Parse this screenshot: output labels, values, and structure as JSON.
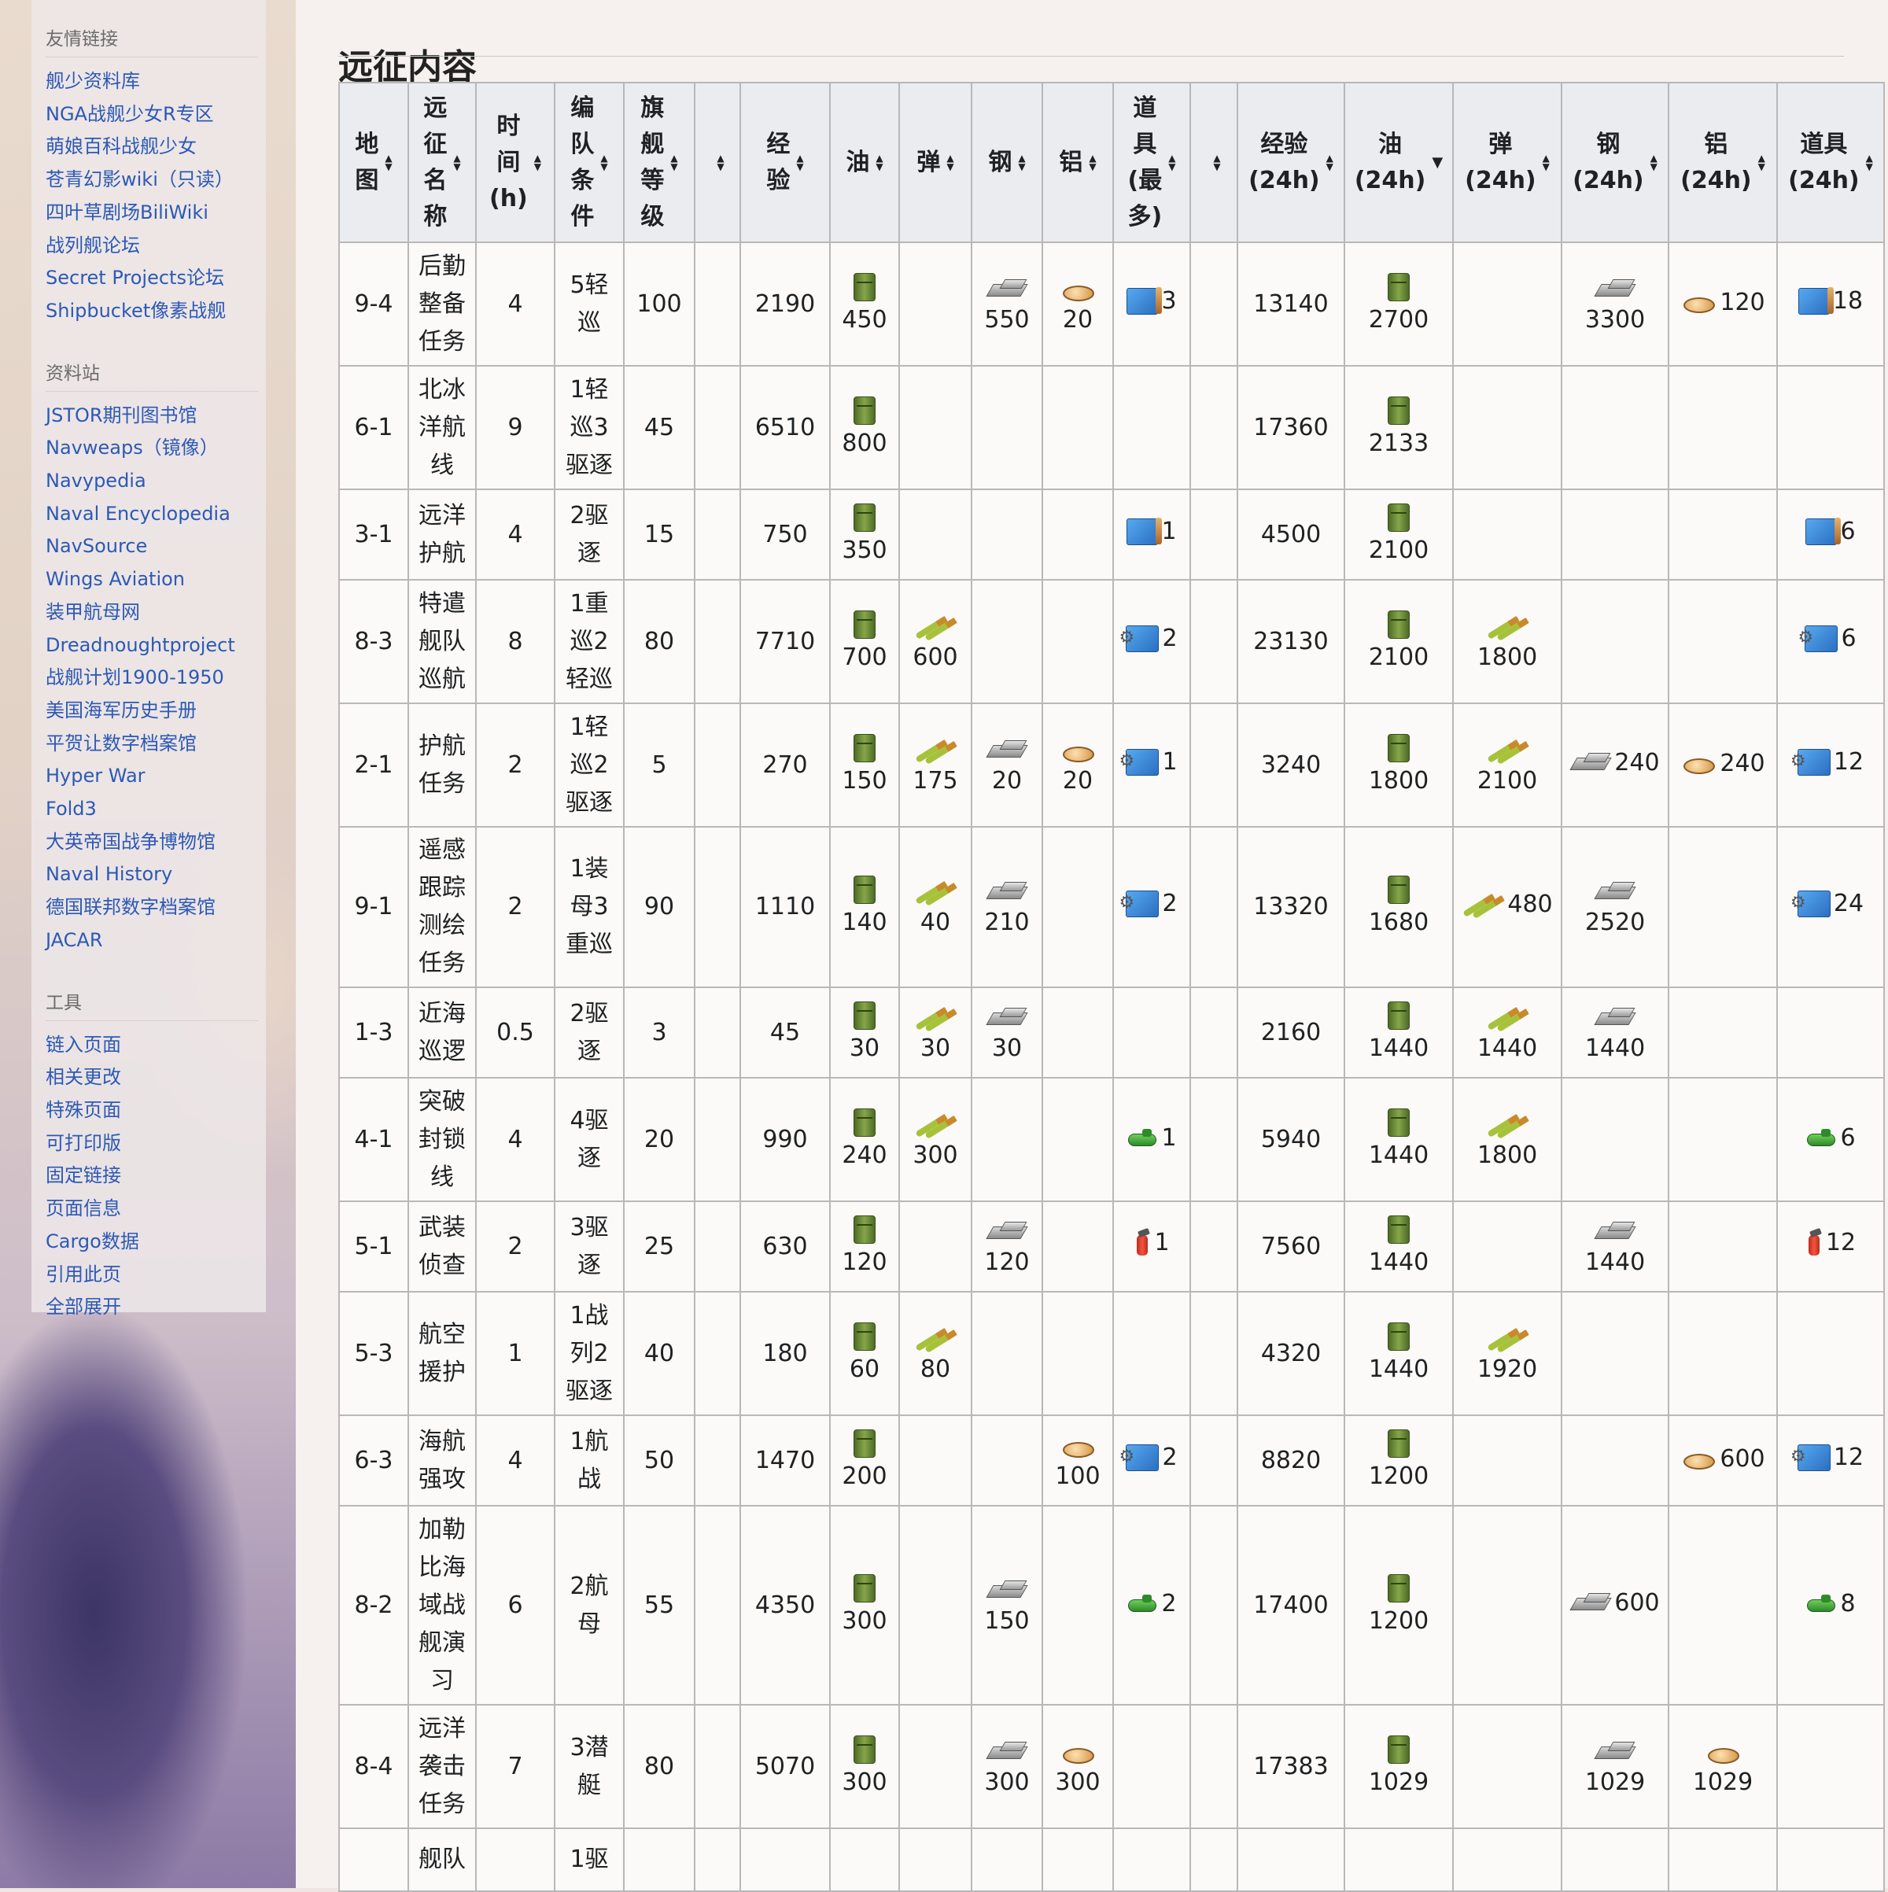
{
  "sidebar": {
    "sections": [
      {
        "heading": "友情链接",
        "links": [
          "舰少资料库",
          "NGA战舰少女R专区",
          "萌娘百科战舰少女",
          "苍青幻影wiki（只读）",
          "四叶草剧场BiliWiki",
          "战列舰论坛",
          "Secret Projects论坛",
          "Shipbucket像素战舰"
        ]
      },
      {
        "heading": "资料站",
        "links": [
          "JSTOR期刊图书馆",
          "Navweaps（镜像）",
          "Navypedia",
          "Naval Encyclopedia",
          "NavSource",
          "Wings Aviation",
          "装甲航母网",
          "Dreadnoughtproject",
          "战舰计划1900-1950",
          "美国海军历史手册",
          "平贺让数字档案馆",
          "Hyper War",
          "Fold3",
          "大英帝国战争博物馆",
          "Naval History",
          "德国联邦数字档案馆",
          "JACAR"
        ]
      },
      {
        "heading": "工具",
        "links": [
          "链入页面",
          "相关更改",
          "特殊页面",
          "可打印版",
          "固定链接",
          "页面信息",
          "Cargo数据",
          "引用此页",
          "全部展开"
        ]
      }
    ]
  },
  "page": {
    "section_title": "远征内容"
  },
  "icons": {
    "oil": "oil-icon",
    "ammo": "ammo-icon",
    "steel": "steel-icon",
    "aluminum": "aluminum-icon",
    "blueprint": "blueprint-icon",
    "equip_blueprint": "equipment-blueprint-icon",
    "fast_repair": "fast-repair-icon",
    "fast_build": "fast-build-icon"
  },
  "table": {
    "headers": [
      {
        "lines": [
          "地",
          "图"
        ],
        "sort": "both"
      },
      {
        "lines": [
          "远",
          "征",
          "名",
          "称"
        ],
        "sort": "both"
      },
      {
        "lines": [
          "时",
          "间",
          "(h)"
        ],
        "sort": "both"
      },
      {
        "lines": [
          "编",
          "队",
          "条",
          "件"
        ],
        "sort": "both"
      },
      {
        "lines": [
          "旗",
          "舰",
          "等",
          "级"
        ],
        "sort": "both"
      },
      {
        "lines": [
          ""
        ],
        "sort": "both"
      },
      {
        "lines": [
          "经",
          "验"
        ],
        "sort": "both"
      },
      {
        "lines": [
          "油"
        ],
        "sort": "both"
      },
      {
        "lines": [
          "弹"
        ],
        "sort": "both"
      },
      {
        "lines": [
          "钢"
        ],
        "sort": "both"
      },
      {
        "lines": [
          "铝"
        ],
        "sort": "both"
      },
      {
        "lines": [
          "道",
          "具",
          "(最",
          "多)"
        ],
        "sort": "both"
      },
      {
        "lines": [
          ""
        ],
        "sort": "both"
      },
      {
        "lines": [
          "经验",
          "(24h)"
        ],
        "sort": "both"
      },
      {
        "lines": [
          "油",
          "(24h)"
        ],
        "sort": "desc"
      },
      {
        "lines": [
          "弹",
          "(24h)"
        ],
        "sort": "both"
      },
      {
        "lines": [
          "钢",
          "(24h)"
        ],
        "sort": "both"
      },
      {
        "lines": [
          "铝",
          "(24h)"
        ],
        "sort": "both"
      },
      {
        "lines": [
          "道具",
          "(24h)"
        ],
        "sort": "both"
      }
    ],
    "rows": [
      {
        "map": "9-4",
        "name": [
          "后勤",
          "整备",
          "任务"
        ],
        "time": "4",
        "fleet": [
          "5轻",
          "巡"
        ],
        "level": "100",
        "exp": "2190",
        "oil": "450",
        "ammo": "",
        "steel": "550",
        "al": "20",
        "item": {
          "icon": "blueprint",
          "count": "3"
        },
        "exp24": "13140",
        "oil24": "2700",
        "ammo24": "",
        "steel24": "3300",
        "al24": "120",
        "item24": {
          "icon": "blueprint",
          "count": "18"
        }
      },
      {
        "map": "6-1",
        "name": [
          "北冰",
          "洋航",
          "线"
        ],
        "time": "9",
        "fleet": [
          "1轻",
          "巡3",
          "驱逐"
        ],
        "level": "45",
        "exp": "6510",
        "oil": "800",
        "ammo": "",
        "steel": "",
        "al": "",
        "item": null,
        "exp24": "17360",
        "oil24": "2133",
        "ammo24": "",
        "steel24": "",
        "al24": "",
        "item24": null
      },
      {
        "map": "3-1",
        "name": [
          "远洋",
          "护航"
        ],
        "time": "4",
        "fleet": [
          "2驱",
          "逐"
        ],
        "level": "15",
        "exp": "750",
        "oil": "350",
        "ammo": "",
        "steel": "",
        "al": "",
        "item": {
          "icon": "blueprint",
          "count": "1"
        },
        "exp24": "4500",
        "oil24": "2100",
        "ammo24": "",
        "steel24": "",
        "al24": "",
        "item24": {
          "icon": "blueprint",
          "count": "6"
        }
      },
      {
        "map": "8-3",
        "name": [
          "特遣",
          "舰队",
          "巡航"
        ],
        "time": "8",
        "fleet": [
          "1重",
          "巡2",
          "轻巡"
        ],
        "level": "80",
        "exp": "7710",
        "oil": "700",
        "ammo": "600",
        "steel": "",
        "al": "",
        "item": {
          "icon": "equip_blueprint",
          "count": "2"
        },
        "exp24": "23130",
        "oil24": "2100",
        "ammo24": "1800",
        "steel24": "",
        "al24": "",
        "item24": {
          "icon": "equip_blueprint",
          "count": "6"
        }
      },
      {
        "map": "2-1",
        "name": [
          "护航",
          "任务"
        ],
        "time": "2",
        "fleet": [
          "1轻",
          "巡2",
          "驱逐"
        ],
        "level": "5",
        "exp": "270",
        "oil": "150",
        "ammo": "175",
        "steel": "20",
        "al": "20",
        "item": {
          "icon": "equip_blueprint",
          "count": "1"
        },
        "exp24": "3240",
        "oil24": "1800",
        "ammo24": "2100",
        "steel24": "240",
        "al24": "240",
        "item24": {
          "icon": "equip_blueprint",
          "count": "12"
        }
      },
      {
        "map": "9-1",
        "name": [
          "遥感",
          "跟踪",
          "测绘",
          "任务"
        ],
        "time": "2",
        "fleet": [
          "1装",
          "母3",
          "重巡"
        ],
        "level": "90",
        "exp": "1110",
        "oil": "140",
        "ammo": "40",
        "steel": "210",
        "al": "",
        "item": {
          "icon": "equip_blueprint",
          "count": "2"
        },
        "exp24": "13320",
        "oil24": "1680",
        "ammo24": "480",
        "steel24": "2520",
        "al24": "",
        "item24": {
          "icon": "equip_blueprint",
          "count": "24"
        }
      },
      {
        "map": "1-3",
        "name": [
          "近海",
          "巡逻"
        ],
        "time": "0.5",
        "fleet": [
          "2驱",
          "逐"
        ],
        "level": "3",
        "exp": "45",
        "oil": "30",
        "ammo": "30",
        "steel": "30",
        "al": "",
        "item": null,
        "exp24": "2160",
        "oil24": "1440",
        "ammo24": "1440",
        "steel24": "1440",
        "al24": "",
        "item24": null
      },
      {
        "map": "4-1",
        "name": [
          "突破",
          "封锁",
          "线"
        ],
        "time": "4",
        "fleet": [
          "4驱",
          "逐"
        ],
        "level": "20",
        "exp": "990",
        "oil": "240",
        "ammo": "300",
        "steel": "",
        "al": "",
        "item": {
          "icon": "fast_repair",
          "count": "1"
        },
        "exp24": "5940",
        "oil24": "1440",
        "ammo24": "1800",
        "steel24": "",
        "al24": "",
        "item24": {
          "icon": "fast_repair",
          "count": "6"
        }
      },
      {
        "map": "5-1",
        "name": [
          "武装",
          "侦查"
        ],
        "time": "2",
        "fleet": [
          "3驱",
          "逐"
        ],
        "level": "25",
        "exp": "630",
        "oil": "120",
        "ammo": "",
        "steel": "120",
        "al": "",
        "item": {
          "icon": "fast_build",
          "count": "1"
        },
        "exp24": "7560",
        "oil24": "1440",
        "ammo24": "",
        "steel24": "1440",
        "al24": "",
        "item24": {
          "icon": "fast_build",
          "count": "12"
        }
      },
      {
        "map": "5-3",
        "name": [
          "航空",
          "援护"
        ],
        "time": "1",
        "fleet": [
          "1战",
          "列2",
          "驱逐"
        ],
        "level": "40",
        "exp": "180",
        "oil": "60",
        "ammo": "80",
        "steel": "",
        "al": "",
        "item": null,
        "exp24": "4320",
        "oil24": "1440",
        "ammo24": "1920",
        "steel24": "",
        "al24": "",
        "item24": null
      },
      {
        "map": "6-3",
        "name": [
          "海航",
          "强攻"
        ],
        "time": "4",
        "fleet": [
          "1航",
          "战"
        ],
        "level": "50",
        "exp": "1470",
        "oil": "200",
        "ammo": "",
        "steel": "",
        "al": "100",
        "item": {
          "icon": "equip_blueprint",
          "count": "2"
        },
        "exp24": "8820",
        "oil24": "1200",
        "ammo24": "",
        "steel24": "",
        "al24": "600",
        "item24": {
          "icon": "equip_blueprint",
          "count": "12"
        }
      },
      {
        "map": "8-2",
        "name": [
          "加勒",
          "比海",
          "域战",
          "舰演",
          "习"
        ],
        "time": "6",
        "fleet": [
          "2航",
          "母"
        ],
        "level": "55",
        "exp": "4350",
        "oil": "300",
        "ammo": "",
        "steel": "150",
        "al": "",
        "item": {
          "icon": "fast_repair",
          "count": "2"
        },
        "exp24": "17400",
        "oil24": "1200",
        "ammo24": "",
        "steel24": "600",
        "al24": "",
        "item24": {
          "icon": "fast_repair",
          "count": "8"
        }
      },
      {
        "map": "8-4",
        "name": [
          "远洋",
          "袭击",
          "任务"
        ],
        "time": "7",
        "fleet": [
          "3潜",
          "艇"
        ],
        "level": "80",
        "exp": "5070",
        "oil": "300",
        "ammo": "",
        "steel": "300",
        "al": "300",
        "item": null,
        "exp24": "17383",
        "oil24": "1029",
        "ammo24": "",
        "steel24": "1029",
        "al24": "1029",
        "item24": null
      },
      {
        "map": "",
        "name": [
          "舰队",
          ""
        ],
        "time": "",
        "fleet": [
          "1驱"
        ],
        "level": "",
        "exp": "",
        "oil": "",
        "ammo": "",
        "steel": "",
        "al": "",
        "item": null,
        "exp24": "",
        "oil24": "",
        "ammo24": "",
        "steel24": "",
        "al24": "",
        "item24": null
      }
    ]
  }
}
